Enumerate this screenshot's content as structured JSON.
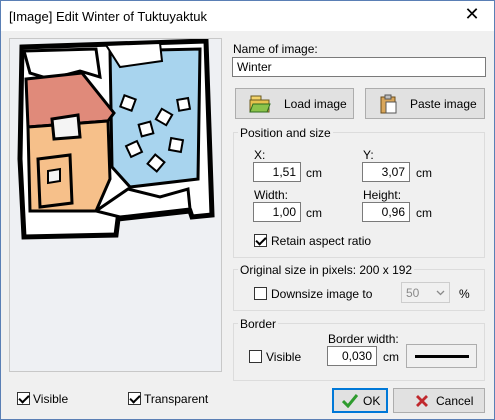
{
  "window": {
    "title": "[Image] Edit Winter of Tuktuyaktuk",
    "close_glyph": "✕"
  },
  "name": {
    "label": "Name of image:",
    "value": "Winter"
  },
  "buttons": {
    "load_image": "Load image",
    "paste_image": "Paste image",
    "ok": "OK",
    "cancel": "Cancel"
  },
  "position": {
    "group_title": "Position and size",
    "x_label": "X:",
    "x_value": "1,51",
    "x_unit": "cm",
    "y_label": "Y:",
    "y_value": "3,07",
    "y_unit": "cm",
    "width_label": "Width:",
    "width_value": "1,00",
    "width_unit": "cm",
    "height_label": "Height:",
    "height_value": "0,96",
    "height_unit": "cm",
    "retain_label": "Retain aspect ratio",
    "retain_checked": true
  },
  "original": {
    "group_title": "Original size in pixels: 200 x 192",
    "downsize_label": "Downsize image to",
    "downsize_checked": false,
    "downsize_value": "50",
    "percent": "%"
  },
  "border": {
    "group_title": "Border",
    "visible_label": "Visible",
    "visible_checked": false,
    "width_label": "Border width:",
    "width_value": "0,030",
    "width_unit": "cm"
  },
  "footer": {
    "visible_label": "Visible",
    "visible_checked": true,
    "transparent_label": "Transparent",
    "transparent_checked": true
  },
  "icons": {
    "close": "close-icon",
    "load": "folder-open-icon",
    "paste": "clipboard-paste-icon",
    "ok": "checkmark-icon",
    "cancel": "red-x-icon",
    "dropdown": "chevron-down-icon"
  },
  "colors": {
    "ok_check": "#2e9b2e",
    "cancel_x": "#c0282d",
    "ok_border": "#0078d7",
    "window_border": "#5a7fb5",
    "preview_bg": "#eef0f3"
  }
}
